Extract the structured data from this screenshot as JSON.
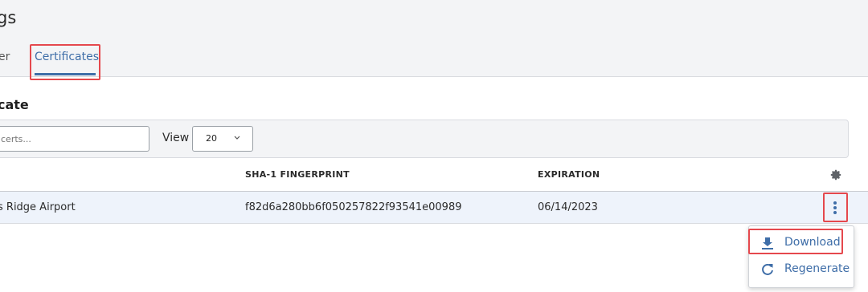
{
  "header": {
    "title": "gs",
    "tabs": [
      {
        "label": "er",
        "active": false
      },
      {
        "label": "Certificates",
        "active": true
      }
    ]
  },
  "section": {
    "title": "cate"
  },
  "toolbar": {
    "search_placeholder": "certs...",
    "view_label": "View",
    "view_value": "20"
  },
  "table": {
    "columns": [
      "SHA-1 FINGERPRINT",
      "EXPIRATION"
    ],
    "rows": [
      {
        "name": "s Ridge Airport",
        "sha1": "f82d6a280bb6f050257822f93541e00989",
        "expiration": "06/14/2023"
      }
    ]
  },
  "menu": {
    "download_label": "Download",
    "regenerate_label": "Regenerate"
  },
  "colors": {
    "accent": "#3f6ea8",
    "highlight": "#e5484d",
    "row_bg": "#eef3fb",
    "header_bg": "#f3f4f6"
  },
  "icons": [
    "chevron-down-icon",
    "gear-icon",
    "kebab-icon",
    "download-icon",
    "refresh-icon"
  ]
}
